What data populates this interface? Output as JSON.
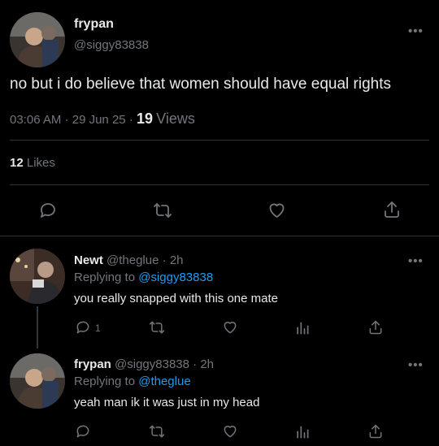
{
  "main_tweet": {
    "display_name": "frypan",
    "handle": "@siggy83838",
    "text": "no but i do believe that women should have equal rights",
    "time": "03:06 AM",
    "sep1": "·",
    "date": "29 Jun 25",
    "sep2": "·",
    "views_count": "19",
    "views_label": "Views",
    "likes_count": "12",
    "likes_label": "Likes",
    "more": "•••"
  },
  "replies": [
    {
      "display_name": "Newt",
      "handle": "@theglue",
      "sep": "·",
      "age": "2h",
      "replying_prefix": "Replying to",
      "replying_to": "@siggy83838",
      "text": "you really snapped with this one mate",
      "reply_count": "1",
      "more": "•••"
    },
    {
      "display_name": "frypan",
      "handle": "@siggy83838",
      "sep": "·",
      "age": "2h",
      "replying_prefix": "Replying to",
      "replying_to": "@theglue",
      "text": "yeah man ik it was just in my head",
      "more": "•••"
    }
  ],
  "icons": {
    "reply": "reply-icon",
    "retweet": "retweet-icon",
    "like": "heart-icon",
    "share": "share-icon",
    "views": "views-icon"
  },
  "colors": {
    "background": "#000000",
    "text": "#e7e9ea",
    "secondary": "#71767b",
    "link": "#1d9bf0",
    "divider": "#2f3336"
  }
}
